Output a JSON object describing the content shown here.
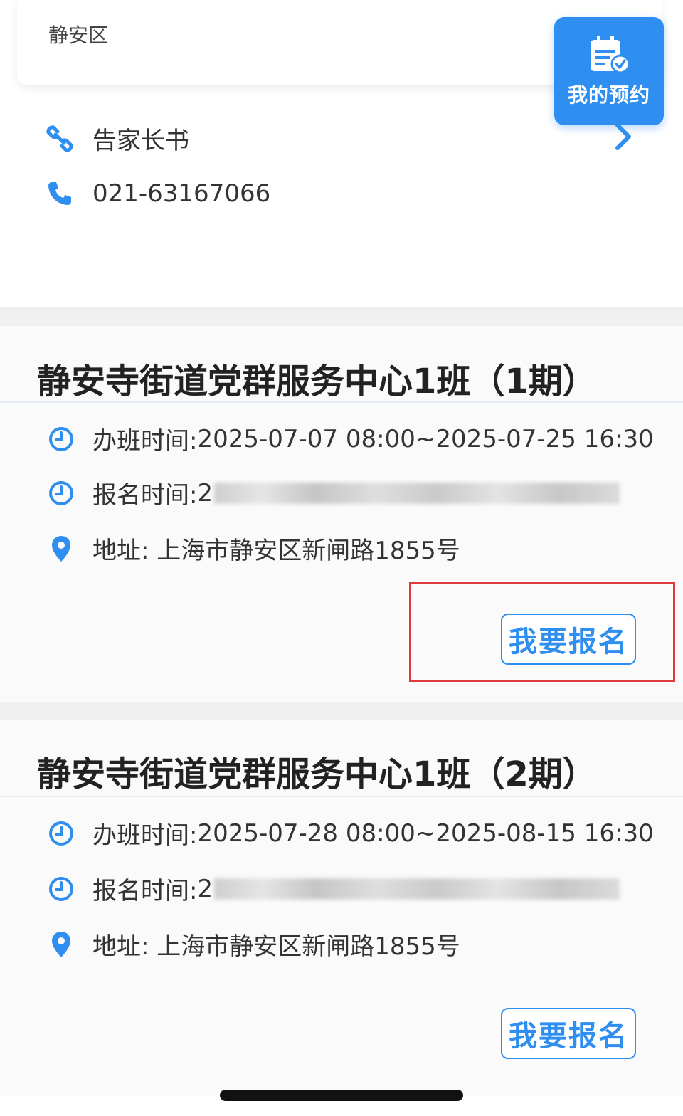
{
  "district_card": {
    "text": "静安区"
  },
  "booking_button": {
    "label": "我的预约",
    "icon": "calendar-check-icon"
  },
  "parent_letter": {
    "label": "告家长书",
    "icon": "link-icon"
  },
  "phone": {
    "number": "021-63167066",
    "icon": "phone-icon"
  },
  "classes": [
    {
      "title": "静安寺街道党群服务中心1班（1期）",
      "class_time_label": "办班时间: ",
      "class_time_value": "2025-07-07 08:00~2025-07-25 16:30",
      "register_time_label": "报名时间: ",
      "register_time_value": "2",
      "address": "地址: 上海市静安区新闸路1855号",
      "signup_label": "我要报名"
    },
    {
      "title": "静安寺街道党群服务中心1班（2期）",
      "class_time_label": "办班时间: ",
      "class_time_value": "2025-07-28 08:00~2025-08-15 16:30",
      "register_time_label": "报名时间: ",
      "register_time_value": "2",
      "address": "地址: 上海市静安区新闸路1855号",
      "signup_label": "我要报名"
    }
  ],
  "colors": {
    "accent": "#2f8ff0",
    "highlight": "#e03a3a"
  }
}
